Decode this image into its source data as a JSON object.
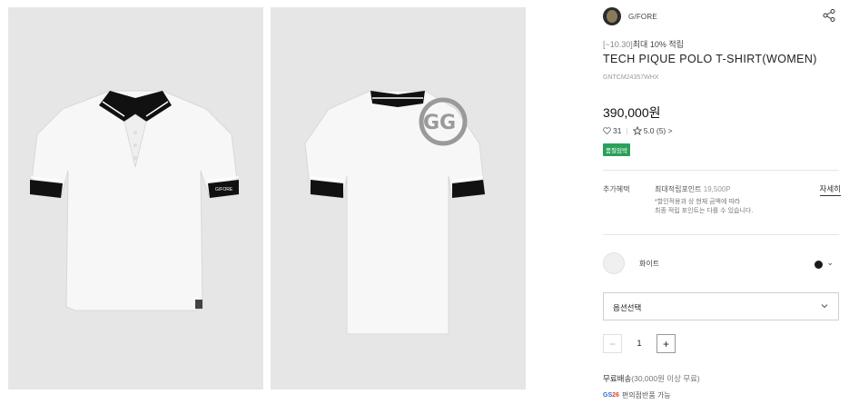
{
  "brand": {
    "name": "G/FORE",
    "logo": "brand-logo-icon"
  },
  "product": {
    "promo_date": "[~10.30]",
    "promo_text": "최대 10% 적립",
    "title": "TECH PIQUE POLO T-SHIRT(WOMEN)",
    "code": "GNTCM24357WHX",
    "price": "390,000원",
    "likes": "31",
    "rating": "5.0 (5) >",
    "badge": "품절임박"
  },
  "benefit": {
    "label": "추가혜택",
    "points_label": "최대적립포인트",
    "points_value": "19,500P",
    "detail_link": "자세히",
    "note_line1": "*할인적용과 상 현재 금액에 따라",
    "note_line2": "최종 적립 포인트는 다를 수 있습니다."
  },
  "option": {
    "color_name": "화이트",
    "selected_color": "#1a1a1a",
    "select_label": "옵션선택"
  },
  "quantity": {
    "minus": "−",
    "value": "1",
    "plus": "+"
  },
  "shipping": {
    "label": "무료배송",
    "detail": "(30,000원 이상 무료)"
  },
  "gs": {
    "logo_prefix": "GS",
    "logo_suffix": "26",
    "text": "편의점반품 가능"
  },
  "images": [
    {
      "alt": "front-view",
      "collar_logo": "G/FORE"
    },
    {
      "alt": "back-view"
    }
  ],
  "colors": {
    "panel_bg": "#e6e6e6",
    "badge": "#2aa05b",
    "shirt": "#f6f6f6",
    "trim": "#111111"
  }
}
